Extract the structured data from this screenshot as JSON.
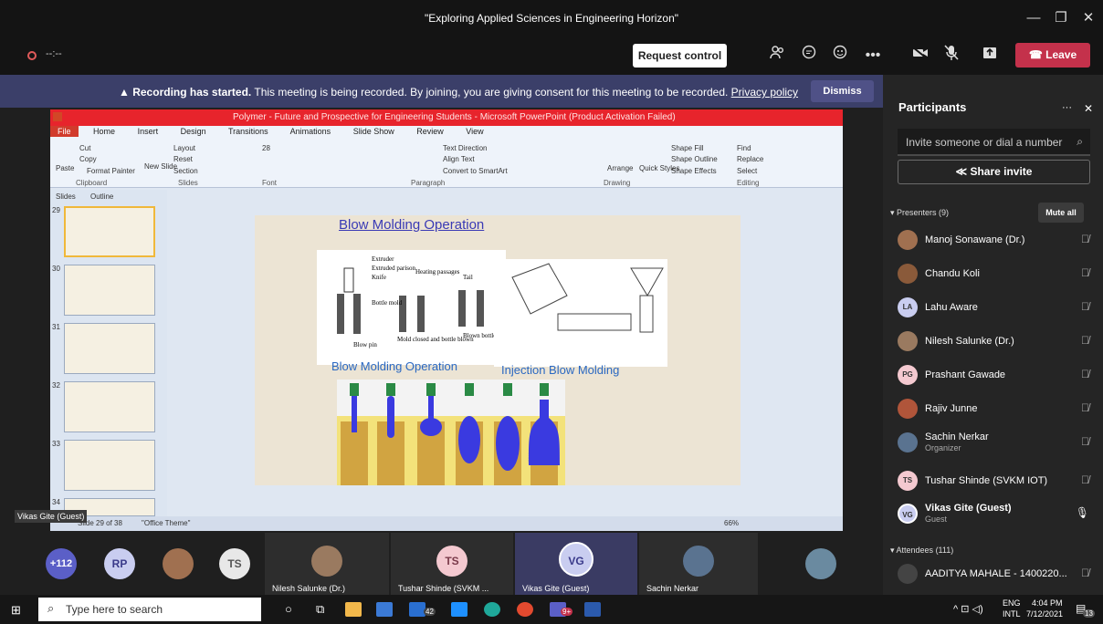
{
  "window": {
    "title": "\"Exploring Applied Sciences in Engineering Horizon\"",
    "minimize": "—",
    "restore": "❐",
    "close": "✕"
  },
  "toolbar": {
    "timer": "--:--",
    "request_control": "Request control",
    "leave": "Leave",
    "icons": [
      "people-icon",
      "chat-icon",
      "reactions-icon",
      "more-icon",
      "camera-off-icon",
      "mic-off-icon",
      "share-icon"
    ]
  },
  "banner": {
    "bold": "Recording has started.",
    "text": "This meeting is being recorded. By joining, you are giving consent for this meeting to be recorded.",
    "link": "Privacy policy",
    "dismiss": "Dismiss"
  },
  "ppt": {
    "title": "Polymer - Future and Prospective for Engineering Students - Microsoft PowerPoint (Product Activation Failed)",
    "tabs": [
      "File",
      "Home",
      "Insert",
      "Design",
      "Transitions",
      "Animations",
      "Slide Show",
      "Review",
      "View"
    ],
    "groups": [
      "Clipboard",
      "Slides",
      "Font",
      "Paragraph",
      "Drawing",
      "Editing"
    ],
    "ribbon": {
      "cut": "Cut",
      "copy": "Copy",
      "paste": "Paste",
      "format_painter": "Format Painter",
      "layout": "Layout",
      "reset": "Reset",
      "section": "Section",
      "new_slide": "New Slide",
      "text_direction": "Text Direction",
      "align_text": "Align Text",
      "convert_smartart": "Convert to SmartArt",
      "shape_fill": "Shape Fill",
      "shape_outline": "Shape Outline",
      "shape_effects": "Shape Effects",
      "arrange": "Arrange",
      "quick_styles": "Quick Styles",
      "find": "Find",
      "replace": "Replace",
      "select": "Select",
      "font_size": "28"
    },
    "pane_tabs": [
      "Slides",
      "Outline"
    ],
    "thumb_numbers": [
      "29",
      "30",
      "31",
      "32",
      "33",
      "34"
    ],
    "slide": {
      "title": "Blow Molding Operation",
      "caption1": "Blow Molding Operation",
      "caption2": "Injection Blow Molding",
      "diagram_labels": [
        "Extruder",
        "Extruded parison",
        "Knife",
        "Heating passages",
        "Tail",
        "Bottle mold",
        "Blow pin",
        "Mold closed and bottle blown",
        "Blown bottle"
      ]
    },
    "status": {
      "slide_info": "Slide 29 of 38",
      "theme": "\"Office Theme\"",
      "zoom": "66%"
    }
  },
  "vikas_tag": "Vikas Gite (Guest)",
  "participants": {
    "header": "Participants",
    "invite_placeholder": "Invite someone or dial a number",
    "share_invite": "Share invite",
    "presenters_label": "Presenters (9)",
    "mute_all": "Mute all",
    "attendees_label": "Attendees (111)",
    "list": [
      {
        "name": "Manoj Sonawane (Dr.)",
        "sub": "",
        "initials": "",
        "color": "#a07050"
      },
      {
        "name": "Chandu Koli",
        "sub": "",
        "initials": "",
        "color": "#8a5a3a"
      },
      {
        "name": "Lahu Aware",
        "sub": "",
        "initials": "LA",
        "color": "#c9cdf0"
      },
      {
        "name": "Nilesh Salunke (Dr.)",
        "sub": "",
        "initials": "",
        "color": "#9a7a60"
      },
      {
        "name": "Prashant Gawade",
        "sub": "",
        "initials": "PG",
        "color": "#f4c9d0"
      },
      {
        "name": "Rajiv Junne",
        "sub": "",
        "initials": "",
        "color": "#b0553a"
      },
      {
        "name": "Sachin Nerkar",
        "sub": "Organizer",
        "initials": "",
        "color": "#5a7390"
      },
      {
        "name": "Tushar Shinde (SVKM IOT)",
        "sub": "",
        "initials": "TS",
        "color": "#f4c9d0"
      },
      {
        "name": "Vikas Gite (Guest)",
        "sub": "Guest",
        "initials": "VG",
        "color": "#c9cdf0"
      }
    ],
    "attendee_first": "AADITYA MAHALE - 1400220..."
  },
  "gallery": {
    "overflow": "+112",
    "tiles": [
      {
        "initials": "RP",
        "name": ""
      },
      {
        "initials": "",
        "name": ""
      },
      {
        "initials": "TS",
        "name": ""
      },
      {
        "initials": "",
        "name": "Nilesh Salunke (Dr.)"
      },
      {
        "initials": "TS",
        "name": "Tushar Shinde (SVKM ..."
      },
      {
        "initials": "VG",
        "name": "Vikas Gite (Guest)"
      },
      {
        "initials": "",
        "name": "Sachin Nerkar"
      },
      {
        "initials": "",
        "name": ""
      }
    ]
  },
  "taskbar": {
    "search_placeholder": "Type here to search",
    "lang": "ENG",
    "lang2": "INTL",
    "time": "4:04 PM",
    "date": "7/12/2021",
    "notifications": "13",
    "mail_badge": "42",
    "teams_badge": "9+"
  }
}
